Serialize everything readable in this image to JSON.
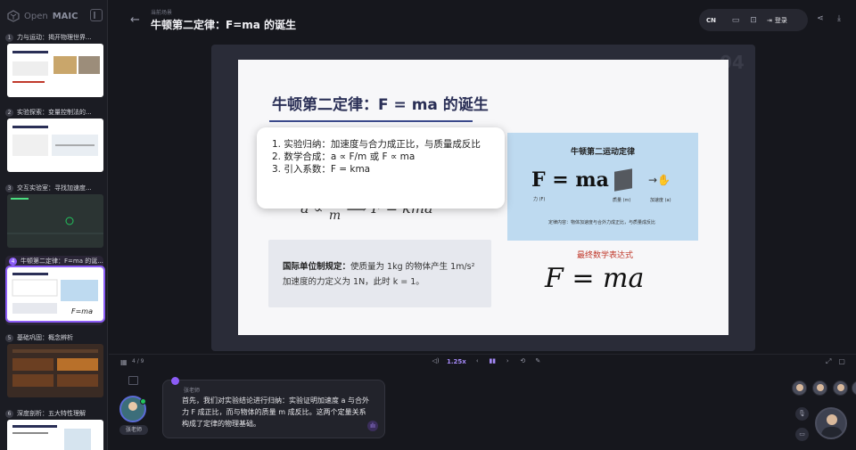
{
  "app": {
    "brand_prefix": "Open",
    "brand_suffix": "MAIC"
  },
  "sidebar": {
    "scenes": [
      {
        "num": "1",
        "label": "力与运动：揭开物理世界..."
      },
      {
        "num": "2",
        "label": "实验探索：变量控制法的..."
      },
      {
        "num": "3",
        "label": "交互实验室：寻找加速度..."
      },
      {
        "num": "4",
        "label": "牛顿第二定律：F=ma 的诞..."
      },
      {
        "num": "5",
        "label": "基础巩固：概念辨析"
      },
      {
        "num": "6",
        "label": "深度剖析：五大特性理解"
      }
    ]
  },
  "header": {
    "breadcrumb": "当前场景",
    "title": "牛顿第二定律：F=ma 的诞生",
    "lang": "CN",
    "login": "登录"
  },
  "stage": {
    "bg_number": "04"
  },
  "slide": {
    "title": "牛顿第二定律：F = ma 的诞生",
    "formula_left": "a ∝",
    "formula_num": "F",
    "formula_den": "m",
    "formula_right": "⟹  F = kma",
    "info_bold": "国际单位制规定：",
    "info_text": "使质量为 1kg 的物体产生 1m/s² 加速度的力定义为 1N，此时 k = 1。",
    "diagram": {
      "title": "牛顿第二运动定律",
      "formula": "F = ma",
      "label_force": "力 (F)",
      "label_mass": "质量 (m)",
      "label_accel": "加速度 (a)",
      "caption": "定律内容：物体加速度与合外力成正比，与质量成反比"
    },
    "final_label": "最终数学表达式",
    "final_formula": "F = ma"
  },
  "bubble": {
    "lines": [
      "1. 实验归纳：加速度与合力成正比，与质量成反比",
      "2. 数学合成：a ∝ F/m 或 F ∝ ma",
      "3. 引入系数：F = kma"
    ]
  },
  "controls": {
    "page": "4 / 9",
    "speed": "1.25x"
  },
  "teacher": {
    "name": "张老师",
    "speech": "首先，我们对实验结论进行归纳：实验证明加速度 a 与合外力 F 成正比，而与物体的质量 m 成反比。这两个定量关系构成了定律的物理基础。"
  },
  "colors": {
    "accent": "#8b5cf6",
    "slide_title": "#2a2f56",
    "red_label": "#c0392b",
    "diagram_bg": "#bedaf0"
  }
}
